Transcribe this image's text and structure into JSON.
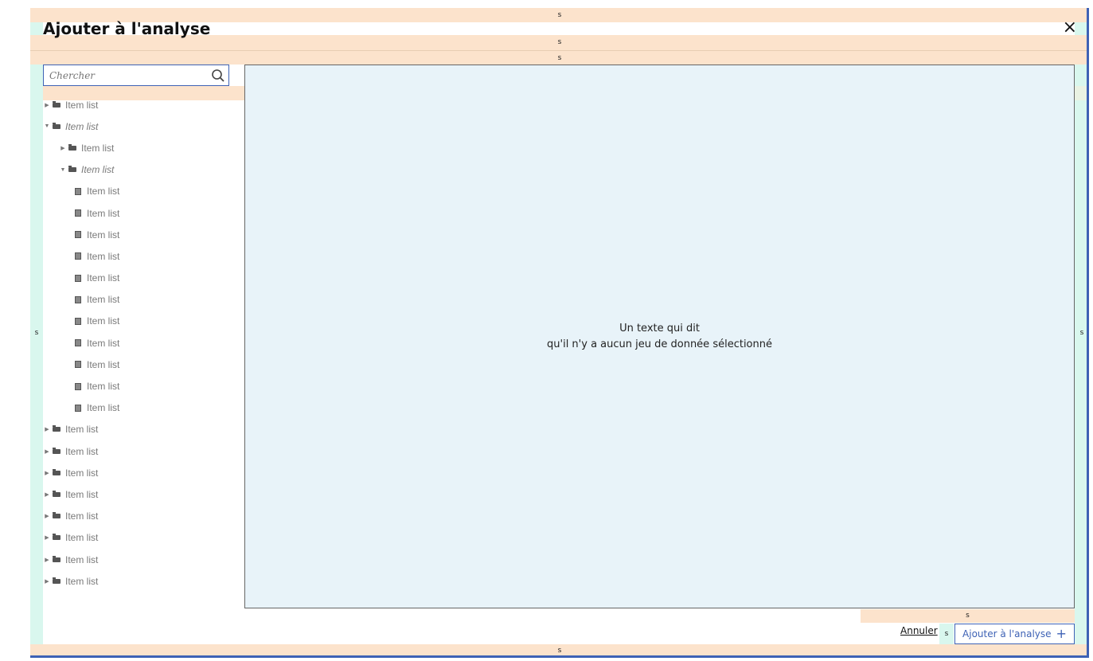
{
  "dialog": {
    "title": "Ajouter à l'analyse",
    "close_label": "×",
    "spacing_marker": "s"
  },
  "search": {
    "placeholder": "Chercher",
    "icon": "search-icon"
  },
  "tree": {
    "items": [
      {
        "label": "Item list",
        "type": "folder",
        "depth": 0,
        "expanded": false
      },
      {
        "label": "Item list",
        "type": "folder",
        "depth": 0,
        "expanded": true
      },
      {
        "label": "Item list",
        "type": "folder",
        "depth": 1,
        "expanded": false
      },
      {
        "label": "Item list",
        "type": "folder",
        "depth": 1,
        "expanded": true
      },
      {
        "label": "Item list",
        "type": "file",
        "depth": 2
      },
      {
        "label": "Item list",
        "type": "file",
        "depth": 2
      },
      {
        "label": "Item list",
        "type": "file",
        "depth": 2
      },
      {
        "label": "Item list",
        "type": "file",
        "depth": 2
      },
      {
        "label": "Item list",
        "type": "file",
        "depth": 2
      },
      {
        "label": "Item list",
        "type": "file",
        "depth": 2
      },
      {
        "label": "Item list",
        "type": "file",
        "depth": 2
      },
      {
        "label": "Item list",
        "type": "file",
        "depth": 2
      },
      {
        "label": "Item list",
        "type": "file",
        "depth": 2
      },
      {
        "label": "Item list",
        "type": "file",
        "depth": 2
      },
      {
        "label": "Item list",
        "type": "file",
        "depth": 2
      },
      {
        "label": "Item list",
        "type": "folder",
        "depth": 0,
        "expanded": false
      },
      {
        "label": "Item list",
        "type": "folder",
        "depth": 0,
        "expanded": false
      },
      {
        "label": "Item list",
        "type": "folder",
        "depth": 0,
        "expanded": false
      },
      {
        "label": "Item list",
        "type": "folder",
        "depth": 0,
        "expanded": false
      },
      {
        "label": "Item list",
        "type": "folder",
        "depth": 0,
        "expanded": false
      },
      {
        "label": "Item list",
        "type": "folder",
        "depth": 0,
        "expanded": false
      },
      {
        "label": "Item list",
        "type": "folder",
        "depth": 0,
        "expanded": false
      },
      {
        "label": "Item list",
        "type": "folder",
        "depth": 0,
        "expanded": false
      }
    ]
  },
  "preview": {
    "line1": "Un texte qui dit",
    "line2": "qu'il n'y a aucun jeu de donnée sélectionné"
  },
  "footer": {
    "cancel_label": "Annuler",
    "add_label": "Ajouter à l'analyse",
    "add_icon": "plus-icon"
  },
  "colors": {
    "accent": "#3e62b5",
    "spacing_horizontal": "#fce3cc",
    "spacing_vertical": "#d9f7ee",
    "preview_bg": "#e8f3f9"
  }
}
